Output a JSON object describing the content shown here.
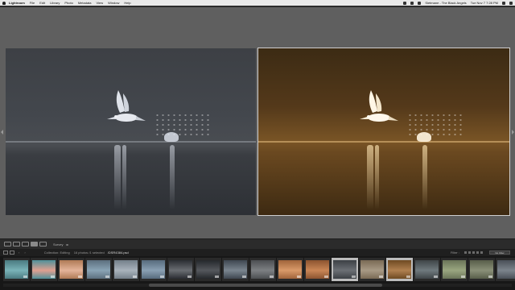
{
  "menubar": {
    "app_name": "Lightroom",
    "items": [
      "File",
      "Edit",
      "Library",
      "Photo",
      "Metadata",
      "View",
      "Window",
      "Help"
    ],
    "user": "Sietmane - The Black Angels",
    "clock": "Tue Nov 7  7:28 PM",
    "search_icon": "search-icon",
    "menu_icon": "list-icon"
  },
  "toolbar": {
    "view_mode": "Survey",
    "buttons": [
      "grid-view-icon",
      "loupe-view-icon",
      "compare-view-icon",
      "survey-view-icon",
      "people-view-icon"
    ]
  },
  "filmstrip": {
    "source": "Collection: Editing",
    "count": "16 photos /1 selected",
    "filename": "/DSR4384.psd",
    "filter_label": "Filter :",
    "filter_value": "No Filter",
    "thumbnails": [
      {
        "colors": [
          "#4a7a80",
          "#7ab3b8"
        ],
        "selected": false
      },
      {
        "colors": [
          "#4f9099",
          "#e0a090"
        ],
        "selected": false
      },
      {
        "colors": [
          "#b07a55",
          "#e4b49a"
        ],
        "selected": false
      },
      {
        "colors": [
          "#5c6f7e",
          "#8aa4b5"
        ],
        "selected": false
      },
      {
        "colors": [
          "#74808a",
          "#a9b3bc"
        ],
        "selected": false
      },
      {
        "colors": [
          "#576b7d",
          "#8aa0b3"
        ],
        "selected": false
      },
      {
        "colors": [
          "#2a2d32",
          "#6a6d72"
        ],
        "selected": false
      },
      {
        "colors": [
          "#25282c",
          "#55585d"
        ],
        "selected": false
      },
      {
        "colors": [
          "#3e4650",
          "#7a858f"
        ],
        "selected": false
      },
      {
        "colors": [
          "#4c4f52",
          "#7d8083"
        ],
        "selected": false
      },
      {
        "colors": [
          "#a0643a",
          "#d99a6a"
        ],
        "selected": false
      },
      {
        "colors": [
          "#8c5430",
          "#c98656"
        ],
        "selected": false
      },
      {
        "colors": [
          "#3c4045",
          "#6c7075"
        ],
        "selected": true
      },
      {
        "colors": [
          "#7a6a55",
          "#a89a85"
        ],
        "selected": false
      },
      {
        "colors": [
          "#6e4a22",
          "#b08050"
        ],
        "selected": true
      },
      {
        "colors": [
          "#3f4548",
          "#707a7e"
        ],
        "selected": false
      },
      {
        "colors": [
          "#6a7458",
          "#9aa680"
        ],
        "selected": false
      },
      {
        "colors": [
          "#585e4a",
          "#8a9078"
        ],
        "selected": false
      },
      {
        "colors": [
          "#4a5058",
          "#7c848c"
        ],
        "selected": false
      }
    ]
  },
  "colors": {
    "work_area": "#5f5f5f",
    "before_tint": "#43474d",
    "after_tint": "#7a5526"
  }
}
